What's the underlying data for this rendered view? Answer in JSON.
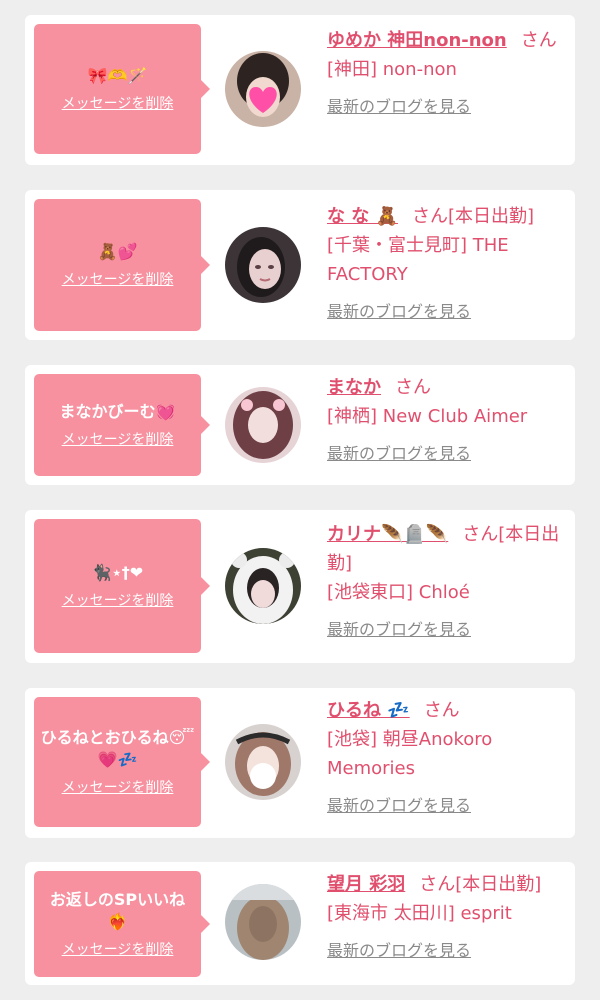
{
  "labels": {
    "delete_message": "メッセージを削除",
    "latest_blog": "最新のブログを見る",
    "honorific": "さん"
  },
  "cards": [
    {
      "message": "🎀🫶🪄",
      "name": "ゆめか 神田non-non",
      "tag": "",
      "shop": "[神田] non-non",
      "avatar_icon": "avatar-photo-yumeka"
    },
    {
      "message": "🧸💕",
      "name": "な な 🧸",
      "tag": "[本日出勤]",
      "shop": "[千葉・富士見町] THE FACTORY",
      "avatar_icon": "avatar-photo-nana"
    },
    {
      "message": "まなかびーむ💓",
      "name": "まなか",
      "tag": "",
      "shop": "[神栖] New Club Aimer",
      "avatar_icon": "avatar-photo-manaka"
    },
    {
      "message": "🐈‍⬛⋆†❤",
      "name": "カリナ🪶🪦🪶",
      "tag": "[本日出勤]",
      "shop": "[池袋東口] Chloé",
      "avatar_icon": "avatar-photo-karina"
    },
    {
      "message": "ひるねとおひるね😴💗💤",
      "name": "ひるね 💤",
      "tag": "",
      "shop": "[池袋] 朝昼Anokoro Memories",
      "avatar_icon": "avatar-photo-hirune"
    },
    {
      "message": "お返しのSPいいね❤️‍🔥",
      "name": "望月 彩羽",
      "tag": "[本日出勤]",
      "shop": "[東海市 太田川] esprit",
      "avatar_icon": "avatar-photo-mochizuki"
    }
  ],
  "colors": {
    "bubble": "#f7919f",
    "accent": "#e0506e",
    "link_gray": "#8a8a8a",
    "background": "#eeeeee"
  }
}
